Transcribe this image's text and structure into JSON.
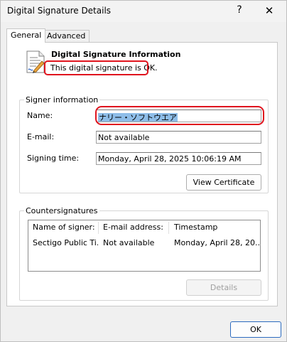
{
  "window": {
    "title": "Digital Signature Details",
    "help_glyph": "?",
    "close_glyph": "✕"
  },
  "tabs": [
    {
      "label": "General",
      "active": true
    },
    {
      "label": "Advanced",
      "active": false
    }
  ],
  "info": {
    "title": "Digital Signature Information",
    "status": "This digital signature is OK."
  },
  "signer": {
    "legend": "Signer information",
    "name_label": "Name:",
    "name_value": "ナリー・ソフトウエア",
    "email_label": "E-mail:",
    "email_value": "Not available",
    "time_label": "Signing time:",
    "time_value": "Monday, April 28, 2025 10:06:19 AM",
    "view_cert_button": "View Certificate"
  },
  "countersignatures": {
    "legend": "Countersignatures",
    "columns": [
      "Name of signer:",
      "E-mail address:",
      "Timestamp"
    ],
    "rows": [
      [
        "Sectigo Public Ti...",
        "Not available",
        "Monday, April 28, 20..."
      ]
    ],
    "details_button": "Details"
  },
  "ok_button": "OK",
  "colors": {
    "highlight_ring": "#e0141e",
    "selection": "#8ebde8",
    "ok_border": "#2c6bbf"
  },
  "icons": {
    "certificate": "certificate-document-icon"
  }
}
